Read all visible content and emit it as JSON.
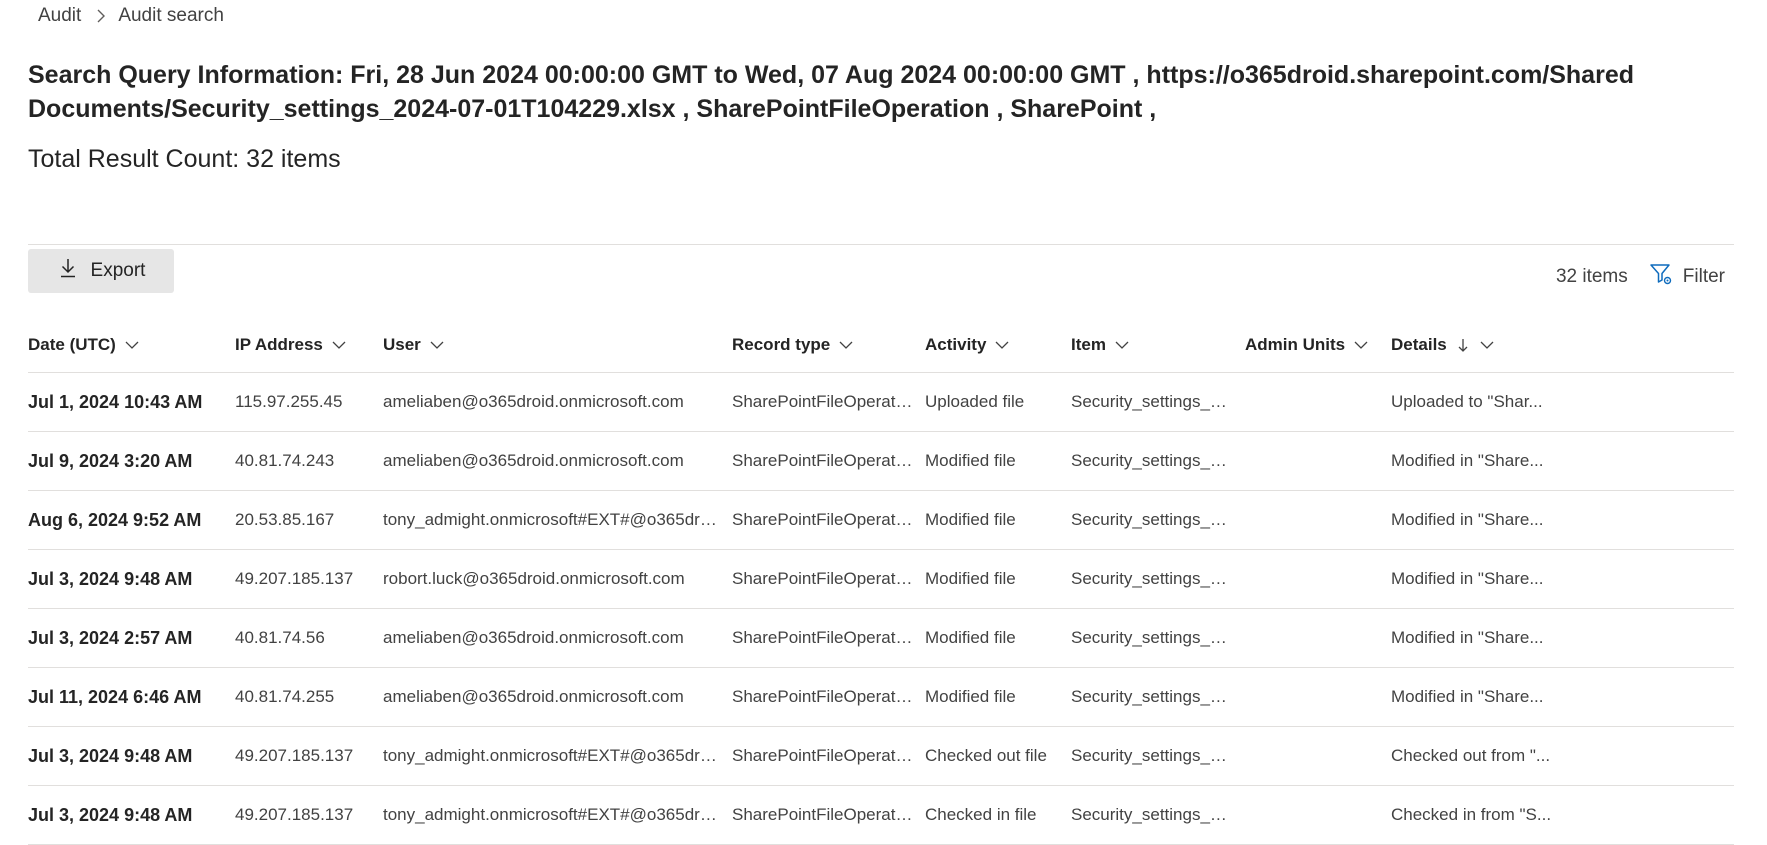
{
  "breadcrumb": {
    "parent": "Audit",
    "current": "Audit search"
  },
  "query": {
    "title": "Search Query Information: Fri, 28 Jun 2024 00:00:00 GMT to Wed, 07 Aug 2024 00:00:00 GMT , https://o365droid.sharepoint.com/Shared Documents/Security_settings_2024-07-01T104229.xlsx , SharePointFileOperation , SharePoint ,",
    "total_count": "Total Result Count: 32 items"
  },
  "toolbar": {
    "export_label": "Export",
    "items_count": "32 items",
    "filter_label": "Filter"
  },
  "columns": {
    "date": "Date (UTC)",
    "ip": "IP Address",
    "user": "User",
    "record_type": "Record type",
    "activity": "Activity",
    "item": "Item",
    "admin_units": "Admin Units",
    "details": "Details"
  },
  "rows": [
    {
      "date": "Jul 1, 2024 10:43 AM",
      "ip": "115.97.255.45",
      "user": "ameliaben@o365droid.onmicrosoft.com",
      "record_type": "SharePointFileOperation",
      "activity": "Uploaded file",
      "item": "Security_settings_2024-...",
      "admin_units": "",
      "details": "Uploaded to \"Shar..."
    },
    {
      "date": "Jul 9, 2024 3:20 AM",
      "ip": "40.81.74.243",
      "user": "ameliaben@o365droid.onmicrosoft.com",
      "record_type": "SharePointFileOperation",
      "activity": "Modified file",
      "item": "Security_settings_2024-...",
      "admin_units": "",
      "details": "Modified in \"Share..."
    },
    {
      "date": "Aug 6, 2024 9:52 AM",
      "ip": "20.53.85.167",
      "user": "tony_admight.onmicrosoft#EXT#@o365droid.onmi...",
      "record_type": "SharePointFileOperation",
      "activity": "Modified file",
      "item": "Security_settings_2024-...",
      "admin_units": "",
      "details": "Modified in \"Share..."
    },
    {
      "date": "Jul 3, 2024 9:48 AM",
      "ip": "49.207.185.137",
      "user": "robort.luck@o365droid.onmicrosoft.com",
      "record_type": "SharePointFileOperation",
      "activity": "Modified file",
      "item": "Security_settings_2024-...",
      "admin_units": "",
      "details": "Modified in \"Share..."
    },
    {
      "date": "Jul 3, 2024 2:57 AM",
      "ip": "40.81.74.56",
      "user": "ameliaben@o365droid.onmicrosoft.com",
      "record_type": "SharePointFileOperation",
      "activity": "Modified file",
      "item": "Security_settings_2024-...",
      "admin_units": "",
      "details": "Modified in \"Share..."
    },
    {
      "date": "Jul 11, 2024 6:46 AM",
      "ip": "40.81.74.255",
      "user": "ameliaben@o365droid.onmicrosoft.com",
      "record_type": "SharePointFileOperation",
      "activity": "Modified file",
      "item": "Security_settings_2024-...",
      "admin_units": "",
      "details": "Modified in \"Share..."
    },
    {
      "date": "Jul 3, 2024 9:48 AM",
      "ip": "49.207.185.137",
      "user": "tony_admight.onmicrosoft#EXT#@o365droid.onmi...",
      "record_type": "SharePointFileOperation",
      "activity": "Checked out file",
      "item": "Security_settings_2024-...",
      "admin_units": "",
      "details": "Checked out from \"..."
    },
    {
      "date": "Jul 3, 2024 9:48 AM",
      "ip": "49.207.185.137",
      "user": "tony_admight.onmicrosoft#EXT#@o365droid.onmi...",
      "record_type": "SharePointFileOperation",
      "activity": "Checked in file",
      "item": "Security_settings_2024-...",
      "admin_units": "",
      "details": "Checked in from \"S..."
    }
  ],
  "colors": {
    "accent": "#0f6cbd",
    "divider": "#e1dfdd",
    "export_bg": "#e6e6e6"
  }
}
